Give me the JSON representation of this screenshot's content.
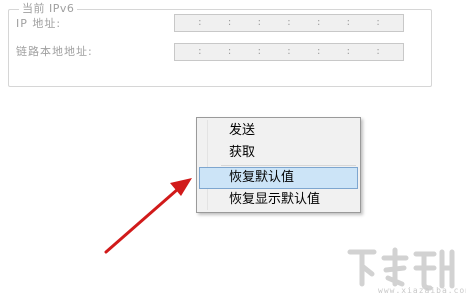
{
  "ipv6_group": {
    "title": "当前 IPv6",
    "fields": [
      {
        "label": "IP 地址:",
        "separators": [
          ":",
          ":",
          ":",
          ":",
          ":",
          ":",
          ":"
        ]
      },
      {
        "label": "链路本地地址:",
        "separators": [
          ":",
          ":",
          ":",
          ":",
          ":",
          ":",
          ":"
        ]
      }
    ]
  },
  "context_menu": {
    "items": [
      {
        "label": "发送"
      },
      {
        "label": "获取"
      },
      {
        "label": "恢复默认值",
        "highlighted": true
      },
      {
        "label": "恢复显示默认值"
      }
    ]
  },
  "watermark": {
    "site": "www.xiazaiba.com"
  },
  "colors": {
    "arrow": "#d11a1a",
    "highlight": "#cce4f7",
    "highlight_border": "#7ea6cf"
  }
}
